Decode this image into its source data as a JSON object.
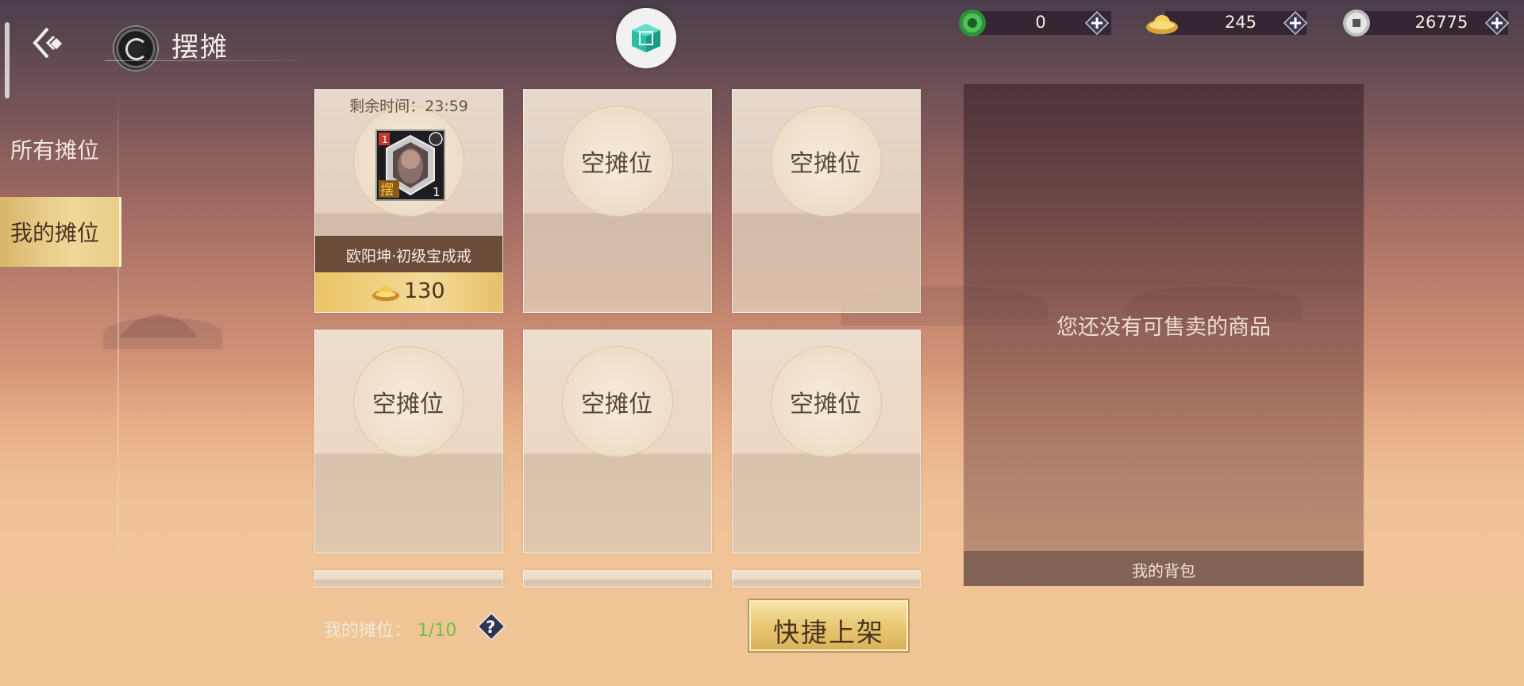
{
  "header": {
    "title": "摆摊"
  },
  "currencies": [
    {
      "name": "jade",
      "value": "0",
      "icon": "green-jade-icon",
      "color": "#3aa64a"
    },
    {
      "name": "gold-ingot",
      "value": "245",
      "icon": "gold-ingot-icon",
      "color": "#e0b440"
    },
    {
      "name": "silver-coin",
      "value": "26775",
      "icon": "silver-coin-icon",
      "color": "#cfcfcf"
    }
  ],
  "tabs": [
    {
      "label": "所有摊位",
      "active": false
    },
    {
      "label": "我的摊位",
      "active": true
    }
  ],
  "stalls": {
    "filled": {
      "timer": "剩余时间：23:59",
      "item_name": "欧阳坤·初级宝成戒",
      "price": "130",
      "badge_text": "摆",
      "quantity": "1",
      "level": "1"
    },
    "empty_label": "空摊位"
  },
  "bag": {
    "empty_message": "您还没有可售卖的商品",
    "footer": "我的背包"
  },
  "footer": {
    "count_label": "我的摊位：",
    "count_value": "1/10",
    "quick_button": "快捷上架"
  }
}
